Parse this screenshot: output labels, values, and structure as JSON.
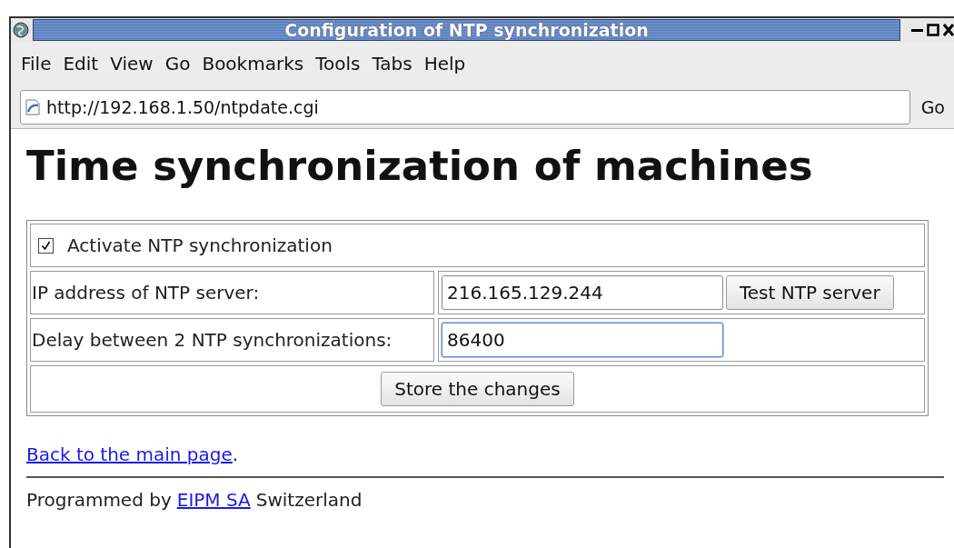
{
  "window": {
    "title": "Configuration of NTP synchronization"
  },
  "menu": [
    "File",
    "Edit",
    "View",
    "Go",
    "Bookmarks",
    "Tools",
    "Tabs",
    "Help"
  ],
  "address_bar": {
    "url": "http://192.168.1.50/ntpdate.cgi",
    "go": "Go"
  },
  "heading": "Time synchronization of machines",
  "form": {
    "activate": {
      "label": "Activate NTP synchronization",
      "checked": true
    },
    "fields": [
      {
        "label": "IP address of NTP server:",
        "value": "216.165.129.244",
        "focused": false,
        "button": "Test NTP server"
      },
      {
        "label": "Delay between 2 NTP synchronizations:",
        "value": "86400",
        "focused": true
      }
    ],
    "submit": "Store the changes"
  },
  "back": {
    "link": "Back to the main page",
    "suffix": "."
  },
  "credit": {
    "prefix": "Programmed by",
    "link": "EIPM SA",
    "suffix": "Switzerland"
  }
}
